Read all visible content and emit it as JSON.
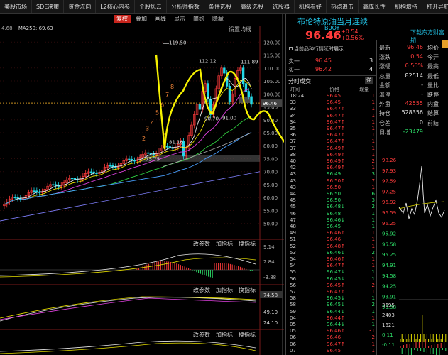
{
  "menu": [
    "美股市场",
    "SDE决策",
    "资金流向",
    "L2核心内参",
    "个股风云",
    "分析师指数",
    "条件选股",
    "高级选股",
    "选股器",
    "机构看好",
    "热点追击",
    "高成长性",
    "机构增持",
    "打开导航"
  ],
  "toolbar": {
    "buttons": [
      "复权",
      "叠加",
      "画线",
      "显示",
      "简约",
      "隐藏"
    ],
    "active": "复权"
  },
  "ma_legend": "MA250: 69.63",
  "ma_legend_prefix": "4.68",
  "settings_label": "设置均线",
  "price_axis": [
    "120.00",
    "115.00",
    "110.00",
    "105.00",
    "100.00",
    "95.00",
    "90.00",
    "85.00",
    "80.00",
    "75.00",
    "70.00",
    "65.00",
    "60.00",
    "55.00",
    "50.00"
  ],
  "annotations": {
    "high": "119.50",
    "peak1": "112.12",
    "peak2": "111.89",
    "low1": "90.70",
    "low2": "91.00",
    "base": "81.16",
    "support": "75.75"
  },
  "price_tag": "96.46",
  "wave_numbers": [
    "2",
    "3",
    "4",
    "5",
    "6",
    "7",
    "8",
    "1"
  ],
  "sub_panel1": {
    "buttons": [
      "改参数",
      "加指标",
      "换指标"
    ],
    "ticks": [
      "9.14",
      "2.84",
      "-3.88"
    ]
  },
  "sub_panel2": {
    "buttons": [
      "改参数",
      "加指标",
      "换指标"
    ],
    "ticks": [
      "74.58",
      "49.10",
      "24.10"
    ]
  },
  "sub_panel3": {
    "buttons": [
      "改参数",
      "加指标",
      "换指标"
    ]
  },
  "stock": {
    "title": "布伦特原油当月连续",
    "code": "B0OY",
    "price": "96.46",
    "change": "+0.54",
    "change_pct": "+0.56%"
  },
  "download_link": "下载东方财富期",
  "order_hint": "当前品种行情延时展示",
  "orderbook": [
    {
      "label": "卖一",
      "price": "96.45",
      "vol": "3"
    },
    {
      "label": "买一",
      "price": "96.42",
      "vol": "4"
    }
  ],
  "trades_header": {
    "title": "分时成交",
    "cols": [
      "时间",
      "价格",
      "现量"
    ],
    "btn": "详"
  },
  "trades": [
    {
      "t": "18:24",
      "p": "96.45",
      "v": "1",
      "c": "red"
    },
    {
      "t": "33",
      "p": "96.45",
      "v": "1",
      "c": "red"
    },
    {
      "t": "33",
      "p": "96.47↑",
      "v": "1",
      "c": "red"
    },
    {
      "t": "34",
      "p": "96.47↑",
      "v": "1",
      "c": "red"
    },
    {
      "t": "34",
      "p": "96.47↑",
      "v": "1",
      "c": "red"
    },
    {
      "t": "35",
      "p": "96.47↑",
      "v": "1",
      "c": "red"
    },
    {
      "t": "36",
      "p": "96.47↑",
      "v": "1",
      "c": "red"
    },
    {
      "t": "37",
      "p": "96.47↑",
      "v": "1",
      "c": "red"
    },
    {
      "t": "37",
      "p": "96.49↑",
      "v": "1",
      "c": "red"
    },
    {
      "t": "38",
      "p": "96.49↑",
      "v": "1",
      "c": "red"
    },
    {
      "t": "40",
      "p": "96.49↑",
      "v": "2",
      "c": "red"
    },
    {
      "t": "42",
      "p": "96.49↑",
      "v": "1",
      "c": "red"
    },
    {
      "t": "43",
      "p": "96.49",
      "v": "3",
      "c": "green"
    },
    {
      "t": "43",
      "p": "96.50↑",
      "v": "7",
      "c": "red"
    },
    {
      "t": "43",
      "p": "96.50",
      "v": "1",
      "c": "red"
    },
    {
      "t": "44",
      "p": "96.50",
      "v": "6",
      "c": "green"
    },
    {
      "t": "45",
      "p": "96.50",
      "v": "3",
      "c": "green"
    },
    {
      "t": "45",
      "p": "96.48↓",
      "v": "2",
      "c": "green"
    },
    {
      "t": "46",
      "p": "96.48",
      "v": "1",
      "c": "green"
    },
    {
      "t": "47",
      "p": "96.46↓",
      "v": "1",
      "c": "green"
    },
    {
      "t": "48",
      "p": "96.45",
      "v": "1",
      "c": "green"
    },
    {
      "t": "49",
      "p": "96.46↑",
      "v": "1",
      "c": "red"
    },
    {
      "t": "51",
      "p": "96.46",
      "v": "1",
      "c": "red"
    },
    {
      "t": "52",
      "p": "96.48↑",
      "v": "1",
      "c": "red"
    },
    {
      "t": "53",
      "p": "96.46↓",
      "v": "2",
      "c": "green"
    },
    {
      "t": "54",
      "p": "96.46↑",
      "v": "1",
      "c": "red"
    },
    {
      "t": "54",
      "p": "96.47↑",
      "v": "1",
      "c": "red"
    },
    {
      "t": "55",
      "p": "96.47↓",
      "v": "1",
      "c": "green"
    },
    {
      "t": "56",
      "p": "96.45↓",
      "v": "1",
      "c": "green"
    },
    {
      "t": "56",
      "p": "96.45↑",
      "v": "2",
      "c": "red"
    },
    {
      "t": "57",
      "p": "96.47↑",
      "v": "1",
      "c": "red"
    },
    {
      "t": "58",
      "p": "96.45↓",
      "v": "1",
      "c": "green"
    },
    {
      "t": "58",
      "p": "96.45↓",
      "v": "2",
      "c": "green"
    },
    {
      "t": "59",
      "p": "96.44↓",
      "v": "1",
      "c": "green"
    },
    {
      "t": "04",
      "p": "96.44↑",
      "v": "1",
      "c": "red"
    },
    {
      "t": "05",
      "p": "96.44↓",
      "v": "1",
      "c": "green"
    },
    {
      "t": "05",
      "p": "96.46↑",
      "v": "31",
      "c": "red"
    },
    {
      "t": "06",
      "p": "96.46",
      "v": "2",
      "c": "red"
    },
    {
      "t": "06",
      "p": "96.47↑",
      "v": "1",
      "c": "red"
    },
    {
      "t": "07",
      "p": "96.45",
      "v": "1",
      "c": "red"
    }
  ],
  "quotes": {
    "left": [
      {
        "label": "最新",
        "val": "96.46",
        "c": "red"
      },
      {
        "label": "涨跌",
        "val": "0.54",
        "c": "red"
      },
      {
        "label": "涨幅",
        "val": "0.56%",
        "c": "red"
      },
      {
        "label": "总量",
        "val": "82514",
        "c": "white"
      },
      {
        "label": "金额",
        "val": "-",
        "c": "white"
      },
      {
        "label": "涨停",
        "val": "-",
        "c": "white"
      },
      {
        "label": "外盘",
        "val": "42555",
        "c": "red"
      },
      {
        "label": "持仓",
        "val": "528356",
        "c": "white"
      },
      {
        "label": "仓差",
        "val": "0",
        "c": "white"
      },
      {
        "label": "日增",
        "val": "-23479",
        "c": "green"
      }
    ],
    "right": [
      "均价",
      "今开",
      "最高",
      "最低",
      "量比",
      "跌停",
      "内盘",
      "结算",
      "前结",
      ""
    ]
  },
  "mini_axis": [
    "98.26",
    "97.93",
    "97.59",
    "97.25",
    "96.92",
    "96.59",
    "96.25",
    "95.92",
    "95.58",
    "95.25",
    "94.91",
    "94.58",
    "94.25",
    "93.91",
    "93.58"
  ],
  "mini_vol_axis": [
    "3695",
    "2403",
    "1621",
    "0.11",
    "-0.11"
  ],
  "colors": {
    "up": "#ff3b3b",
    "down": "#2ee06a",
    "accent": "#22c3e6",
    "annotation": "#f5f000"
  }
}
